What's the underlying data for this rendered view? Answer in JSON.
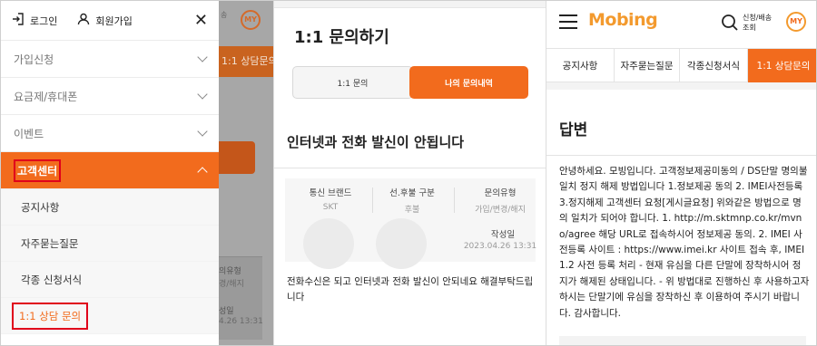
{
  "panel1": {
    "drawer_top": {
      "login_label": "로그인",
      "signup_label": "회원가입",
      "close_glyph": "✕"
    },
    "menu": [
      {
        "label": "가입신청"
      },
      {
        "label": "요금제/휴대폰"
      },
      {
        "label": "이벤트"
      },
      {
        "label": "고객센터"
      }
    ],
    "submenu": [
      {
        "label": "공지사항"
      },
      {
        "label": "자주묻는질문"
      },
      {
        "label": "각종 신청서식"
      },
      {
        "label": "1:1 상담 문의"
      }
    ],
    "background": {
      "my_label": "MY",
      "top_small": "송",
      "consult_tab": "1:1 상담문의",
      "card_type_label": "의유형",
      "card_type_value": "경/해지",
      "card_date_label": "성일",
      "card_date_value": "4.26 13:31"
    }
  },
  "panel2": {
    "title": "1:1 문의하기",
    "tabs": [
      {
        "label": "1:1 문의"
      },
      {
        "label": "나의 문의내역"
      }
    ],
    "question_title": "인터넷과 전화 발신이 안됩니다",
    "info": {
      "brand_label": "통신 브랜드",
      "brand_value": "SKT",
      "pay_label": "선.후불 구분",
      "pay_value": "후불",
      "type_label": "문의유형",
      "type_value": "가입/변경/해지",
      "date_label": "작성일",
      "date_value": "2023.04.26 13:31"
    },
    "question_body": "전화수신은 되고 인터넷과 전화 발신이 안되네요 해결부탁드립니다"
  },
  "panel3": {
    "logo": "Mobing",
    "search_label": "신청/배송 조회",
    "my_label": "MY",
    "tabs": [
      {
        "label": "공지사항"
      },
      {
        "label": "자주묻는질문"
      },
      {
        "label": "각종신청서식"
      },
      {
        "label": "1:1 상담문의"
      }
    ],
    "answer_title": "답변",
    "answer_body": "안녕하세요. 모빙입니다. 고객정보제공미동의 / DS단말 명의불일치 정지 해제 방법입니다 1.정보제공 동의 2. IMEI사전등록 3.정지해제 고객센터 요청[게시글요청] 위와같은 방법으로 명의 일치가 되어야 합니다. 1. http://m.sktmnp.co.kr/mvno/agree 해당 URL로 접속하시어 정보제공 동의. 2. IMEI 사전등록 사이트 : https://www.imei.kr 사이트 접속 후, IMEI 1.2 사전 등록 처리 - 현재 유심을 다른 단말에 장착하시어 정지가 해제된 상태입니다. - 위 방법대로 진행하신 후 사용하고자 하시는 단말기에 유심을 장착하신 후 이용하여 주시기 바랍니다. 감사합니다."
  },
  "colors": {
    "accent": "#f26b1d",
    "highlight_border": "#e0001b",
    "logo": "#f39a2e"
  }
}
